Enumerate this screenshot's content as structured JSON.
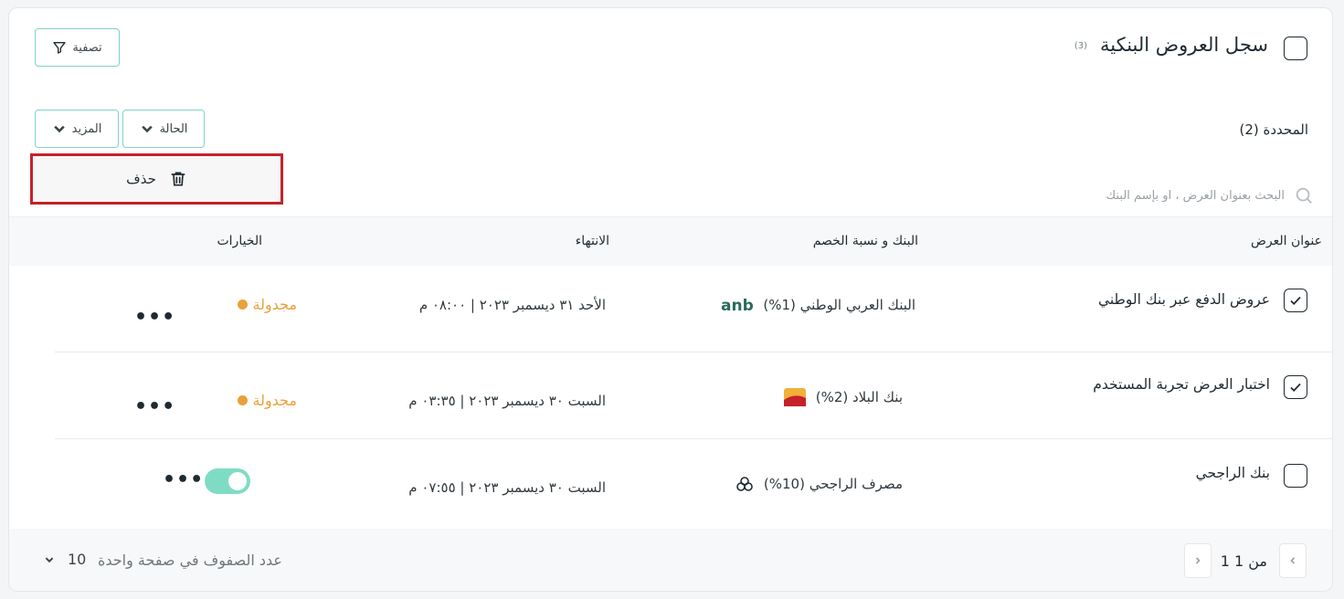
{
  "header": {
    "title": "سجل العروض البنكية",
    "count": "(3)",
    "filter_label": "تصفية"
  },
  "toolbar": {
    "selected_label": "المحددة (2)",
    "status_dropdown": "الحالة",
    "more_dropdown": "المزيد",
    "delete_label": "حذف",
    "search_placeholder": "البحث بعنوان العرض ، او بإسم البنك"
  },
  "table": {
    "columns": {
      "title": "عنوان العرض",
      "bank": "البنك و نسبة الخصم",
      "end": "الانتهاء",
      "options": "الخيارات"
    },
    "rows": [
      {
        "checked": true,
        "title": "عروض الدفع عبر بنك الوطني",
        "bank": "البنك العربي الوطني (1%)",
        "end": "الأحد ٣١ ديسمبر ٢٠٢٣ | ٠٨:٠٠ م",
        "status": "مجدولة",
        "logo": "anb-logo-icon"
      },
      {
        "checked": true,
        "title": "اختبار العرض تجربة المستخدم",
        "bank": "بنك البلاد (2%)",
        "end": "السبت ٣٠ ديسمبر ٢٠٢٣ | ٠٣:٣٥ م",
        "status": "مجدولة",
        "logo": "albilad-logo-icon"
      },
      {
        "checked": false,
        "title": "بنك الراجحي",
        "bank": "مصرف الراجحي (10%)",
        "end": "السبت ٣٠ ديسمبر ٢٠٢٣ | ٠٧:٥٥ م",
        "status": "",
        "toggle_on": true,
        "logo": "alrajhi-logo-icon"
      }
    ]
  },
  "footer": {
    "page_info": "1 من 1",
    "rows_per_page_label": "عدد الصفوف في صفحة واحدة",
    "rows_per_page_value": "10",
    "prev_icon": "chevron-left-icon",
    "next_icon": "chevron-right-icon"
  },
  "colors": {
    "accent": "#7fd3c5",
    "status_scheduled": "#e9a13a",
    "highlight": "#c5222b",
    "toggle": "#7fdcc4"
  }
}
